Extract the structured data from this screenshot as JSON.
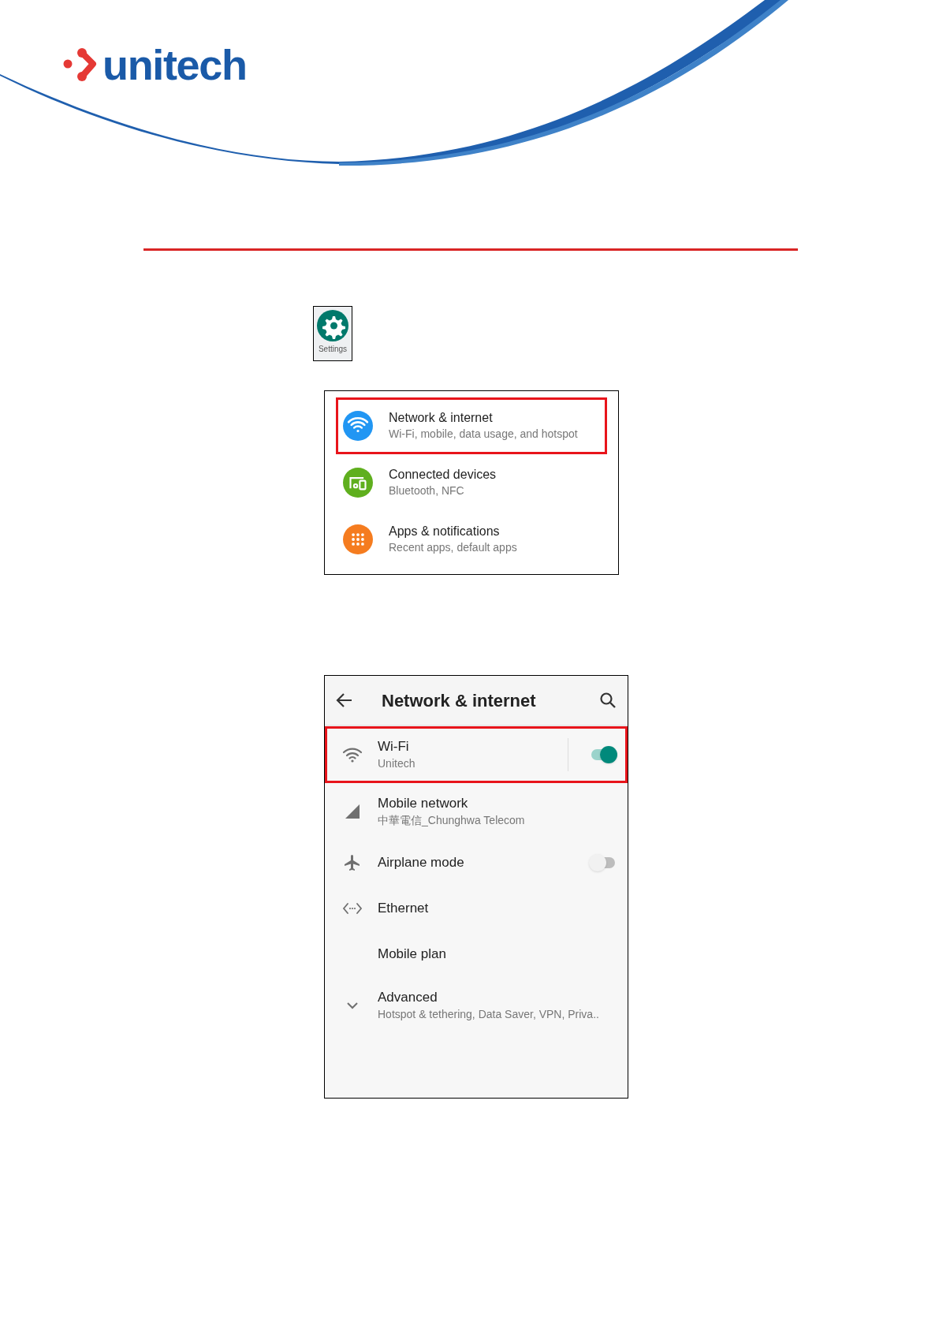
{
  "logo": {
    "text": "unitech"
  },
  "app_icon": {
    "label": "Settings"
  },
  "settings_list": [
    {
      "kind": "wifi",
      "title": "Network & internet",
      "subtitle": "Wi-Fi, mobile, data usage, and hotspot",
      "color": "#2196f3",
      "highlighted": true
    },
    {
      "kind": "devices",
      "title": "Connected devices",
      "subtitle": "Bluetooth, NFC",
      "color": "#5faf1e",
      "highlighted": false
    },
    {
      "kind": "apps",
      "title": "Apps & notifications",
      "subtitle": "Recent apps, default apps",
      "color": "#f57c1f",
      "highlighted": false
    }
  ],
  "network_screen": {
    "title": "Network & internet",
    "items": [
      {
        "kind": "wifi",
        "title": "Wi-Fi",
        "subtitle": "Unitech",
        "on": true,
        "highlighted": true
      },
      {
        "kind": "signal",
        "title": "Mobile network",
        "subtitle": "中華電信_Chunghwa Telecom",
        "highlighted": false
      },
      {
        "kind": "airplane",
        "title": "Airplane mode",
        "on": false,
        "highlighted": false
      },
      {
        "kind": "ethernet",
        "title": "Ethernet",
        "highlighted": false
      },
      {
        "kind": "none",
        "title": "Mobile plan",
        "highlighted": false
      },
      {
        "kind": "chevron",
        "title": "Advanced",
        "subtitle": "Hotspot & tethering, Data Saver, VPN, Priva..",
        "highlighted": false
      }
    ]
  }
}
